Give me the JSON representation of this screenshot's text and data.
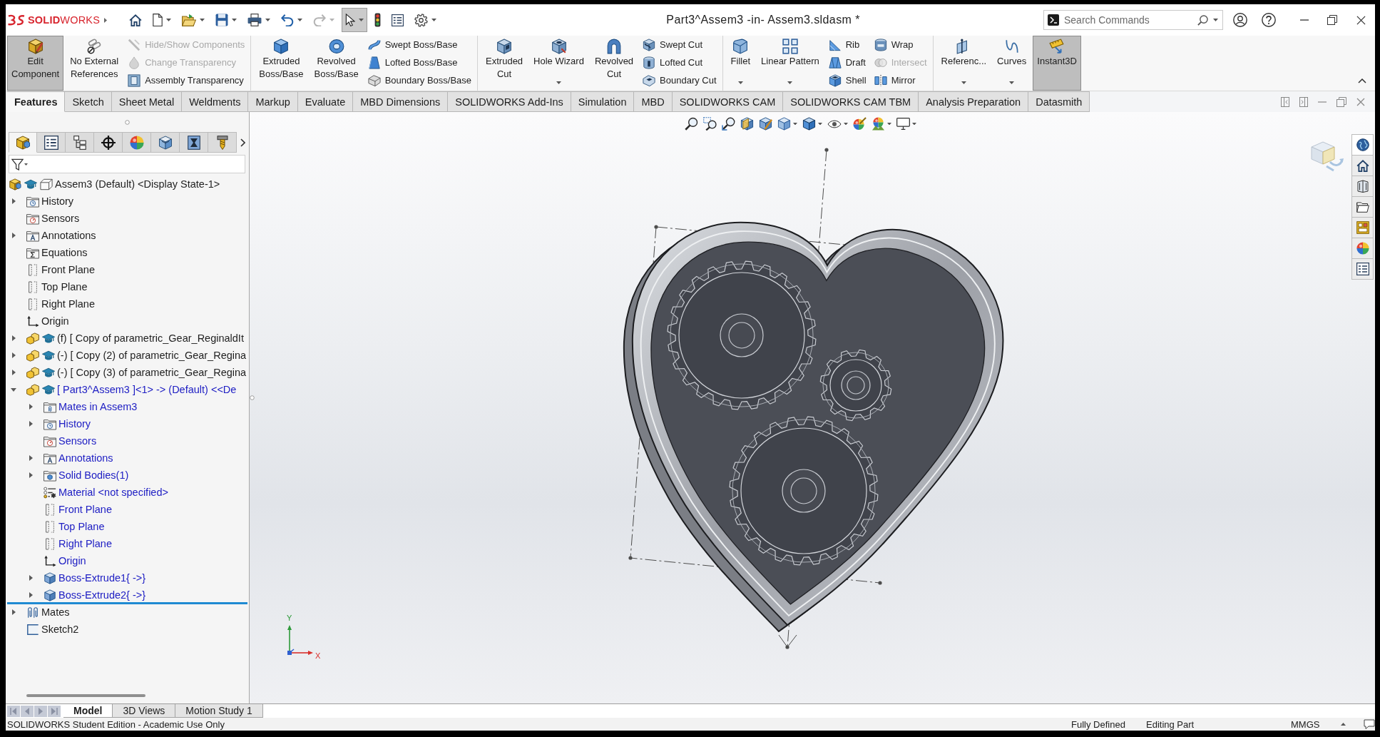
{
  "title_bar": {
    "logo": "**SOLID**WORKS",
    "quick_access": [
      {
        "pressed": false,
        "disabled": false
      },
      {
        "pressed": false,
        "disabled": false
      },
      {
        "pressed": false,
        "disabled": false
      },
      {
        "pressed": false,
        "disabled": false
      },
      {
        "pressed": false,
        "disabled": false
      },
      {
        "pressed": false,
        "disabled": false
      },
      {
        "pressed": false,
        "disabled": true
      },
      {
        "pressed": true,
        "disabled": false
      },
      {
        "pressed": false,
        "disabled": false
      },
      {
        "pressed": false,
        "disabled": false
      },
      {
        "pressed": false,
        "disabled": false
      }
    ],
    "document_title": "Part3^Assem3 -in- Assem3.sldasm *",
    "search": {
      "placeholder": "Search Commands"
    }
  },
  "ribbon": {
    "groups": [
      {
        "items": [
          {
            "kind": "large",
            "label": "Edit\nComponent",
            "pressed": true,
            "disabled": false,
            "dropdown": false
          },
          {
            "kind": "large",
            "label": "No External\nReferences",
            "pressed": false,
            "disabled": false,
            "dropdown": false
          },
          {
            "kind": "stack",
            "items": [
              {
                "label": "Hide/Show Components",
                "disabled": true
              },
              {
                "label": "Change Transparency",
                "disabled": true
              },
              {
                "label": "Assembly Transparency",
                "disabled": false
              }
            ]
          }
        ]
      },
      {
        "items": [
          {
            "kind": "large",
            "label": "Extruded\nBoss/Base",
            "pressed": false,
            "disabled": false,
            "dropdown": false
          },
          {
            "kind": "large",
            "label": "Revolved\nBoss/Base",
            "pressed": false,
            "disabled": false,
            "dropdown": false
          },
          {
            "kind": "stack",
            "items": [
              {
                "label": "Swept Boss/Base",
                "disabled": false
              },
              {
                "label": "Lofted Boss/Base",
                "disabled": false
              },
              {
                "label": "Boundary Boss/Base",
                "disabled": false
              }
            ]
          }
        ]
      },
      {
        "items": [
          {
            "kind": "large",
            "label": "Extruded\nCut",
            "pressed": false,
            "disabled": false,
            "dropdown": false
          },
          {
            "kind": "large",
            "label": "Hole Wizard",
            "pressed": false,
            "disabled": false,
            "dropdown": true
          },
          {
            "kind": "large",
            "label": "Revolved\nCut",
            "pressed": false,
            "disabled": false,
            "dropdown": false
          },
          {
            "kind": "stack",
            "items": [
              {
                "label": "Swept Cut",
                "disabled": false
              },
              {
                "label": "Lofted Cut",
                "disabled": false
              },
              {
                "label": "Boundary Cut",
                "disabled": false
              }
            ]
          }
        ]
      },
      {
        "items": [
          {
            "kind": "large",
            "label": "Fillet",
            "pressed": false,
            "disabled": false,
            "dropdown": true
          },
          {
            "kind": "large",
            "label": "Linear Pattern",
            "pressed": false,
            "disabled": false,
            "dropdown": true
          },
          {
            "kind": "stack",
            "items": [
              {
                "label": "Rib",
                "disabled": false
              },
              {
                "label": "Draft",
                "disabled": false
              },
              {
                "label": "Shell",
                "disabled": false
              }
            ]
          },
          {
            "kind": "stack",
            "items": [
              {
                "label": "Wrap",
                "disabled": false
              },
              {
                "label": "Intersect",
                "disabled": true
              },
              {
                "label": "Mirror",
                "disabled": false
              }
            ]
          }
        ]
      },
      {
        "items": [
          {
            "kind": "large",
            "label": "Referenc...",
            "pressed": false,
            "disabled": false,
            "dropdown": true
          },
          {
            "kind": "large",
            "label": "Curves",
            "pressed": false,
            "disabled": false,
            "dropdown": true
          },
          {
            "kind": "large",
            "label": "Instant3D",
            "pressed": true,
            "disabled": false,
            "dropdown": false
          }
        ]
      }
    ]
  },
  "command_tabs": [
    {
      "label": "Features",
      "selected": true
    },
    {
      "label": "Sketch",
      "selected": false
    },
    {
      "label": "Sheet Metal",
      "selected": false
    },
    {
      "label": "Weldments",
      "selected": false
    },
    {
      "label": "Markup",
      "selected": false
    },
    {
      "label": "Evaluate",
      "selected": false
    },
    {
      "label": "MBD Dimensions",
      "selected": false
    },
    {
      "label": "SOLIDWORKS Add-Ins",
      "selected": false
    },
    {
      "label": "Simulation",
      "selected": false
    },
    {
      "label": "MBD",
      "selected": false
    },
    {
      "label": "SOLIDWORKS CAM",
      "selected": false
    },
    {
      "label": "SOLIDWORKS CAM TBM",
      "selected": false
    },
    {
      "label": "Analysis Preparation",
      "selected": false
    },
    {
      "label": "Datasmith",
      "selected": false
    }
  ],
  "feature_manager": {
    "panel_tabs": [
      {
        "selected": true
      },
      {
        "selected": false
      },
      {
        "selected": false
      },
      {
        "selected": false
      },
      {
        "selected": false
      },
      {
        "selected": false
      },
      {
        "selected": false
      },
      {
        "selected": false
      }
    ],
    "tree": [
      {
        "kind": "assembly",
        "label": "Assem3 (Default) <Display State-1>",
        "editing": false,
        "children": [
          {
            "kind": "history",
            "label": "History",
            "expanded": false,
            "editing": false
          },
          {
            "kind": "sensors",
            "label": "Sensors",
            "editing": false
          },
          {
            "kind": "annotations",
            "label": "Annotations",
            "expanded": false,
            "editing": false
          },
          {
            "kind": "equations",
            "label": "Equations",
            "editing": false
          },
          {
            "kind": "plane",
            "label": "Front Plane",
            "editing": false
          },
          {
            "kind": "plane",
            "label": "Top Plane",
            "editing": false
          },
          {
            "kind": "plane",
            "label": "Right Plane",
            "editing": false
          },
          {
            "kind": "origin",
            "label": "Origin",
            "editing": false
          },
          {
            "kind": "component",
            "label": "(f) [ Copy of parametric_Gear_ReginaldIt",
            "expanded": false,
            "editing": false
          },
          {
            "kind": "component",
            "label": "(-) [ Copy (2) of parametric_Gear_Regina",
            "expanded": false,
            "editing": false
          },
          {
            "kind": "component",
            "label": "(-) [ Copy (3) of parametric_Gear_Regina",
            "expanded": false,
            "editing": false
          },
          {
            "kind": "component",
            "label": "[ Part3^Assem3 ]<1> -> (Default) <<De",
            "expanded": true,
            "editing": true,
            "children": [
              {
                "kind": "mates_folder",
                "label": "Mates in Assem3",
                "expanded": false,
                "editing": true
              },
              {
                "kind": "history",
                "label": "History",
                "expanded": false,
                "editing": true
              },
              {
                "kind": "sensors",
                "label": "Sensors",
                "editing": true
              },
              {
                "kind": "annotations",
                "label": "Annotations",
                "expanded": false,
                "editing": true
              },
              {
                "kind": "solid_bodies",
                "label": "Solid Bodies(1)",
                "expanded": false,
                "editing": true
              },
              {
                "kind": "material",
                "label": "Material <not specified>",
                "editing": true
              },
              {
                "kind": "plane",
                "label": "Front Plane",
                "editing": true
              },
              {
                "kind": "plane",
                "label": "Top Plane",
                "editing": true
              },
              {
                "kind": "plane",
                "label": "Right Plane",
                "editing": true
              },
              {
                "kind": "origin",
                "label": "Origin",
                "editing": true
              },
              {
                "kind": "extrude",
                "label": "Boss-Extrude1{ ->}",
                "expanded": false,
                "editing": true
              },
              {
                "kind": "extrude",
                "label": "Boss-Extrude2{ ->}",
                "expanded": false,
                "editing": true
              }
            ]
          },
          {
            "kind": "rollback_bar"
          },
          {
            "kind": "mates",
            "label": "Mates",
            "expanded": false,
            "editing": false
          },
          {
            "kind": "sketch",
            "label": "Sketch2",
            "editing": false
          }
        ]
      }
    ]
  },
  "graphics": {
    "triad": {
      "y_label": "Y",
      "x_label": "X"
    }
  },
  "bottom_tabs": [
    {
      "label": "Model",
      "selected": true
    },
    {
      "label": "3D Views",
      "selected": false
    },
    {
      "label": "Motion Study 1",
      "selected": false
    }
  ],
  "status_bar": {
    "edition": "SOLIDWORKS Student Edition - Academic Use Only",
    "definition": "Fully Defined",
    "mode": "Editing Part",
    "units": "MMGS"
  }
}
